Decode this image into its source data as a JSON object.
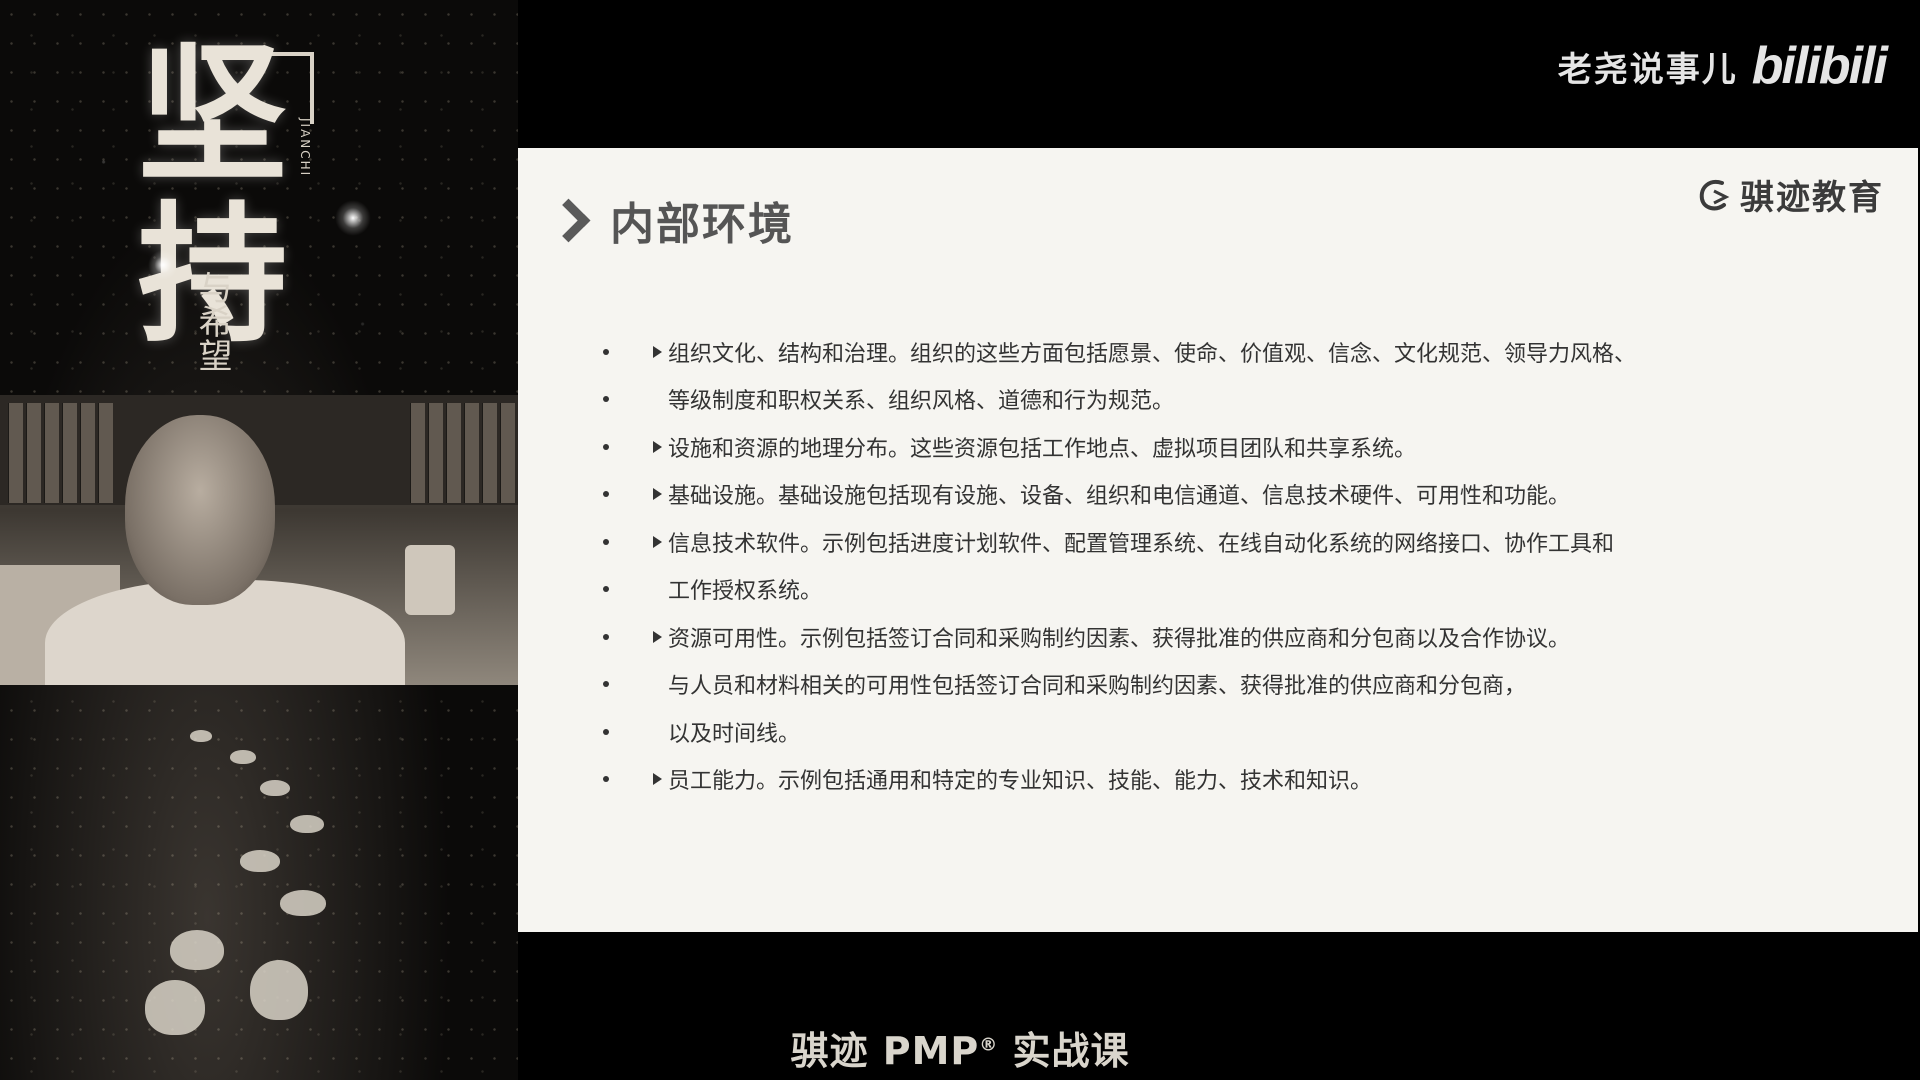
{
  "poster": {
    "title": "坚持",
    "subtitle": "与希望",
    "pinyin": "JIANCHI"
  },
  "brand": {
    "channel": "老尧说事儿",
    "platform": "bilibili"
  },
  "slide": {
    "title": "内部环境",
    "logo_text": "骐迹教育",
    "items": [
      {
        "text": "组织文化、结构和治理。组织的这些方面包括愿景、使命、价值观、信念、文化规范、领导力风格、",
        "marker": true
      },
      {
        "text": "等级制度和职权关系、组织风格、道德和行为规范。",
        "marker": false
      },
      {
        "text": "设施和资源的地理分布。这些资源包括工作地点、虚拟项目团队和共享系统。",
        "marker": true
      },
      {
        "text": "基础设施。基础设施包括现有设施、设备、组织和电信通道、信息技术硬件、可用性和功能。",
        "marker": true
      },
      {
        "text": "信息技术软件。示例包括进度计划软件、配置管理系统、在线自动化系统的网络接口、协作工具和",
        "marker": true
      },
      {
        "text": "工作授权系统。",
        "marker": false
      },
      {
        "text": "资源可用性。示例包括签订合同和采购制约因素、获得批准的供应商和分包商以及合作协议。",
        "marker": true
      },
      {
        "text": "与人员和材料相关的可用性包括签订合同和采购制约因素、获得批准的供应商和分包商，",
        "marker": false
      },
      {
        "text": "以及时间线。",
        "marker": false
      },
      {
        "text": "员工能力。示例包括通用和特定的专业知识、技能、能力、技术和知识。",
        "marker": true
      }
    ]
  },
  "caption": {
    "prefix": "骐迹 PMP",
    "reg": "®",
    "suffix": " 实战课"
  }
}
